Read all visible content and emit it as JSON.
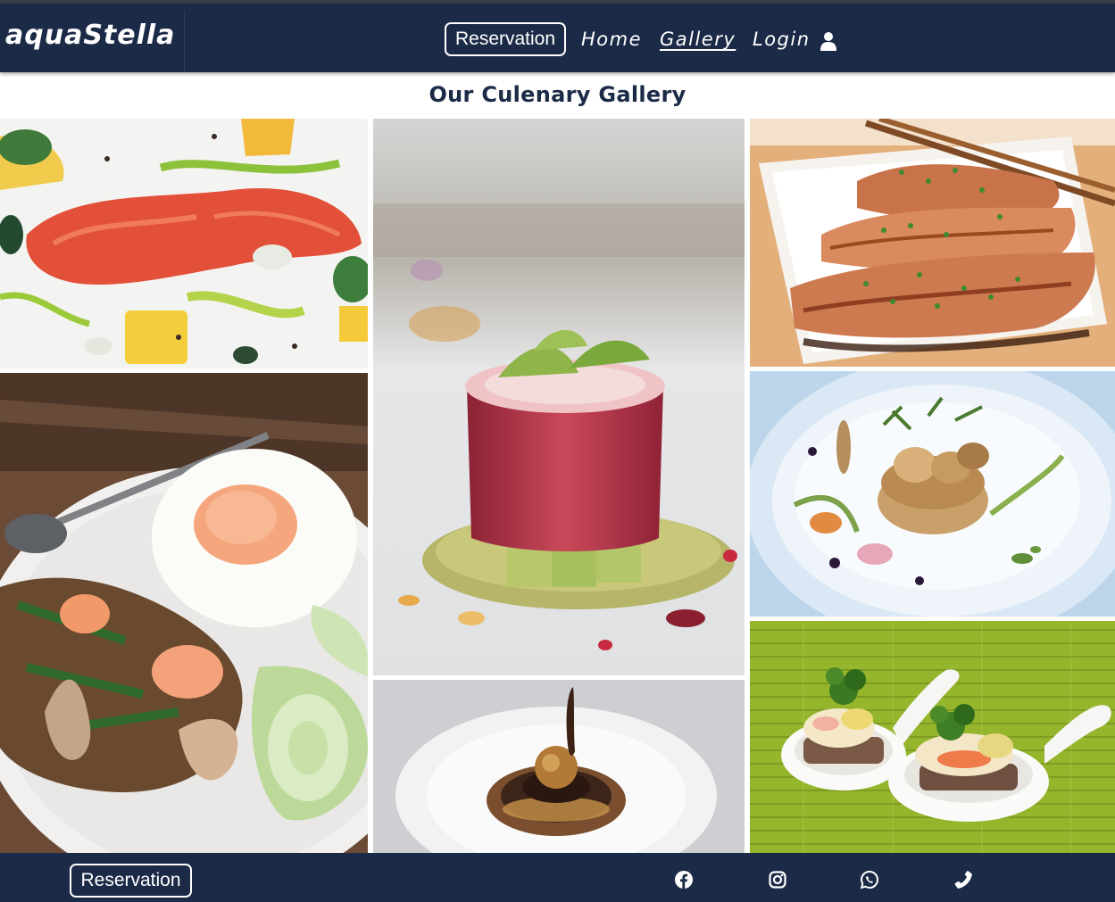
{
  "brand": {
    "logo_text": "aquaStella"
  },
  "nav": {
    "reservation_label": "Reservation",
    "home_label": "Home",
    "gallery_label": "Gallery",
    "login_label": "Login",
    "login_icon": "user-icon",
    "active_item": "Gallery"
  },
  "gallery": {
    "title": "Our Culenary Gallery",
    "images": [
      {
        "name": "salmon-sashimi-plate"
      },
      {
        "name": "egg-shrimp-squid-rice-plate"
      },
      {
        "name": "tuna-tower-on-avocado"
      },
      {
        "name": "chocolate-dessert-plate"
      },
      {
        "name": "grilled-salmon-platter"
      },
      {
        "name": "scallop-on-grain-plate"
      },
      {
        "name": "spoon-canapes-on-bamboo"
      }
    ]
  },
  "footer": {
    "reservation_label": "Reservation",
    "social_icons": [
      "facebook-icon",
      "instagram-icon",
      "whatsapp-icon",
      "phone-icon"
    ]
  },
  "colors": {
    "navy": "#1b2a46",
    "white": "#ffffff",
    "bamboo_green": "#95b52c"
  }
}
